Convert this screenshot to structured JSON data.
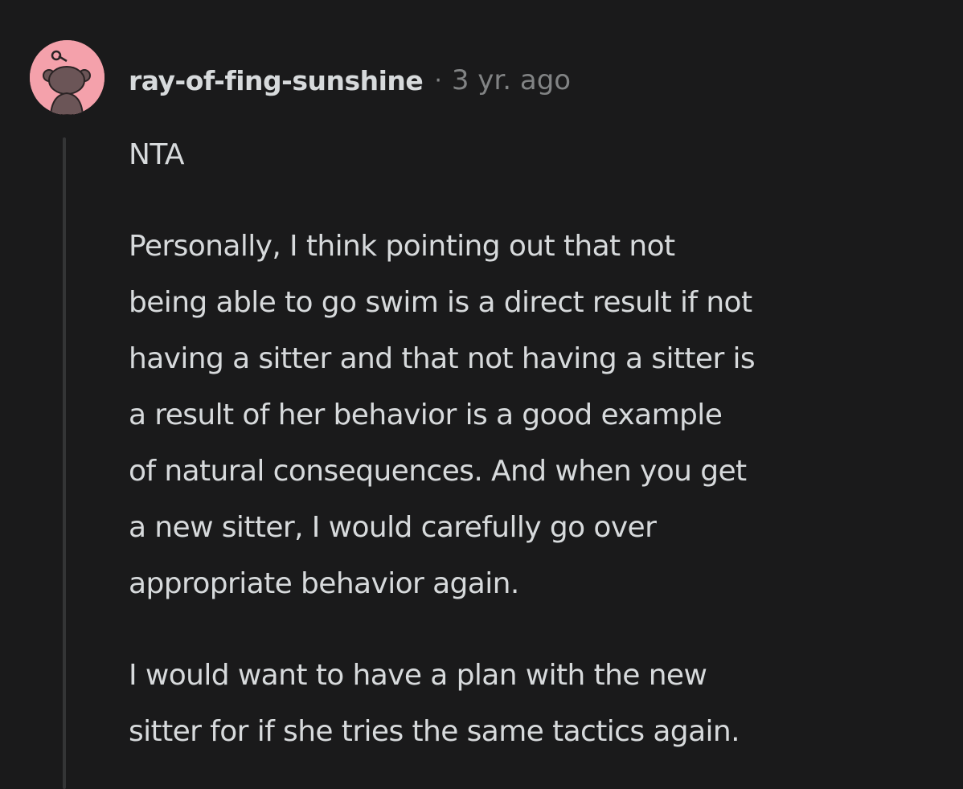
{
  "comment": {
    "author": "ray-of-fing-sunshine",
    "separator": "·",
    "timestamp": "3 yr. ago",
    "avatar_icon": "snoo-avatar-icon",
    "avatar_color": "#f4a1ab",
    "paragraphs": [
      {
        "lines": [
          "NTA"
        ]
      },
      {
        "lines": [
          "Personally, I think pointing out that not",
          "being able to go swim is a direct result if not",
          "having a sitter and that not having a sitter is",
          "a result of her behavior is a good example",
          "of natural consequences. And when you get",
          "a new sitter, I would carefully go over",
          "appropriate behavior again."
        ]
      },
      {
        "lines": [
          "I would want to have a plan with the new",
          "sitter for if she tries the same tactics again."
        ]
      }
    ]
  },
  "colors": {
    "background": "#1a1a1b",
    "text": "#d7dadc",
    "muted": "#818384",
    "thread_line": "#343536"
  }
}
